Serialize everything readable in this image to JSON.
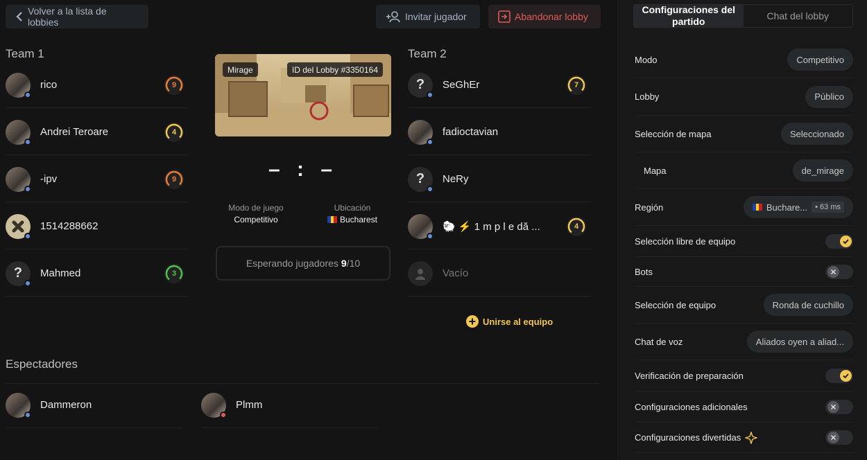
{
  "topbar": {
    "back_label": "Volver a la lista de lobbies",
    "invite_label": "Invitar jugador",
    "leave_label": "Abandonar lobby"
  },
  "team1": {
    "title": "Team 1",
    "players": [
      {
        "name": "rico",
        "level": "9",
        "level_color": "#e87b35",
        "avatar": "photo"
      },
      {
        "name": "Andrei Teroare",
        "level": "4",
        "level_color": "#f0c654",
        "avatar": "photo"
      },
      {
        "name": "-ipv",
        "level": "9",
        "level_color": "#e87b35",
        "avatar": "photo"
      },
      {
        "name": "1514288662",
        "level": "",
        "level_color": "",
        "avatar": "pattern"
      },
      {
        "name": "Mahmed",
        "level": "3",
        "level_color": "#4cc24c",
        "avatar": "unknown"
      }
    ]
  },
  "team2": {
    "title": "Team 2",
    "players": [
      {
        "name": "SeGhEr",
        "level": "7",
        "level_color": "#f0c654",
        "avatar": "unknown"
      },
      {
        "name": "fadioctavian",
        "level": "",
        "level_color": "",
        "avatar": "photo"
      },
      {
        "name": "NeRy",
        "level": "",
        "level_color": "",
        "avatar": "unknown"
      },
      {
        "name": "🐑 ⚡ 1 m p l e dă ...",
        "level": "4",
        "level_color": "#f0c654",
        "avatar": "photo"
      },
      {
        "name": "Vacío",
        "level": "",
        "level_color": "",
        "avatar": "empty"
      }
    ],
    "join_label": "Unirse al equipo"
  },
  "match": {
    "map_name": "Mirage",
    "lobby_id": "ID del Lobby #3350164",
    "score": "– : –",
    "mode_label": "Modo de juego",
    "mode_value": "Competitivo",
    "location_label": "Ubicación",
    "location_value": "Bucharest",
    "waiting_text": "Esperando jugadores",
    "waiting_current": "9",
    "waiting_total": "/10"
  },
  "spectators": {
    "title": "Espectadores",
    "list": [
      {
        "name": "Dammeron"
      },
      {
        "name": "Plmm"
      }
    ]
  },
  "panel": {
    "tab_settings": "Configuraciones del partido",
    "tab_chat": "Chat del lobby",
    "settings": [
      {
        "label": "Modo",
        "type": "pill",
        "value": "Competitivo"
      },
      {
        "label": "Lobby",
        "type": "pill",
        "value": "Público"
      },
      {
        "label": "Selección de mapa",
        "type": "pill",
        "value": "Seleccionado"
      },
      {
        "label": "Mapa",
        "type": "pill",
        "value": "de_mirage"
      },
      {
        "label": "Región",
        "type": "region",
        "value": "Buchare...",
        "ping": "• 63 ms"
      },
      {
        "label": "Selección libre de equipo",
        "type": "toggle",
        "on": true
      },
      {
        "label": "Bots",
        "type": "toggle",
        "on": false
      },
      {
        "label": "Selección de equipo",
        "type": "pill",
        "value": "Ronda de cuchillo"
      },
      {
        "label": "Chat de voz",
        "type": "pill",
        "value": "Aliados oyen a aliad..."
      },
      {
        "label": "Verificación de preparación",
        "type": "toggle",
        "on": true
      },
      {
        "label": "Configuraciones adicionales",
        "type": "toggle",
        "on": false
      },
      {
        "label": "Configuraciones divertidas",
        "type": "toggle",
        "on": false
      }
    ]
  },
  "colors": {
    "accent": "#f0c654",
    "danger": "#e05a5a",
    "background": "#141414"
  }
}
